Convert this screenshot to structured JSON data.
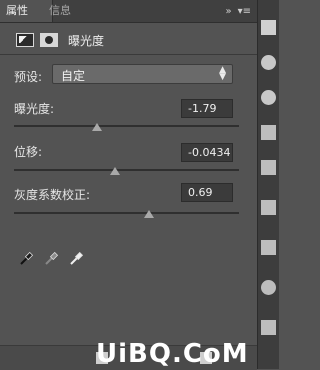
{
  "tabs": [
    {
      "label": "属性"
    },
    {
      "label": "信息"
    }
  ],
  "tab_menu_icons": [
    "double-chevron-right-icon",
    "menu-icon"
  ],
  "header": {
    "title": "曝光度",
    "icons": [
      "adjustment-layer-icon",
      "mask-icon"
    ]
  },
  "preset": {
    "label": "预设:",
    "value": "自定"
  },
  "sliders": [
    {
      "label": "曝光度:",
      "value": "-1.79",
      "position": 0.37
    },
    {
      "label": "位移:",
      "value": "-0.0434",
      "position": 0.45
    },
    {
      "label": "灰度系数校正:",
      "value": "0.69",
      "position": 0.6
    }
  ],
  "eyedroppers": [
    "black-point-eyedropper-icon",
    "gray-point-eyedropper-icon",
    "white-point-eyedropper-icon"
  ],
  "watermark": "UiBQ.CoM",
  "colors": {
    "panel_bg": "#535353",
    "tabbar_bg": "#404040",
    "input_bg": "#3b3b3b",
    "select_bg": "#6a6a6a",
    "track": "#2f2f2f",
    "thumb": "#a9a9a9"
  }
}
